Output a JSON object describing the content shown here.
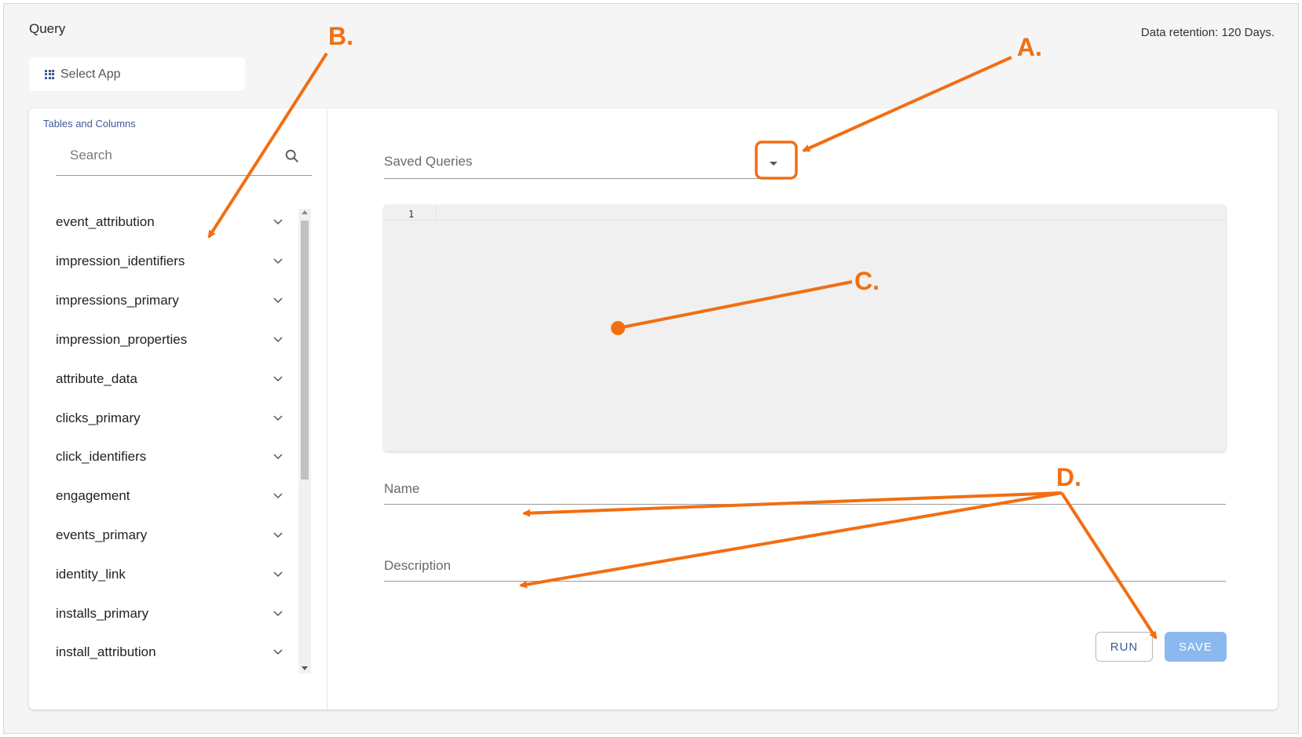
{
  "header": {
    "title": "Query",
    "retention": "Data retention: 120 Days."
  },
  "app_selector": {
    "label": "Select App",
    "icon": "grid-icon"
  },
  "sidebar": {
    "heading": "Tables and Columns",
    "search_placeholder": "Search",
    "tables": [
      {
        "name": "event_attribution"
      },
      {
        "name": "impression_identifiers"
      },
      {
        "name": "impressions_primary"
      },
      {
        "name": "impression_properties"
      },
      {
        "name": "attribute_data"
      },
      {
        "name": "clicks_primary"
      },
      {
        "name": "click_identifiers"
      },
      {
        "name": "engagement"
      },
      {
        "name": "events_primary"
      },
      {
        "name": "identity_link"
      },
      {
        "name": "installs_primary"
      },
      {
        "name": "install_attribution"
      }
    ]
  },
  "main": {
    "saved_queries_label": "Saved Queries",
    "editor": {
      "line_number": "1"
    },
    "name_placeholder": "Name",
    "description_placeholder": "Description",
    "run_label": "RUN",
    "save_label": "SAVE"
  },
  "annotations": {
    "a": "A.",
    "b": "B.",
    "c": "C.",
    "d": "D."
  },
  "colors": {
    "accent": "#3d5a99",
    "annotation": "#f26e12",
    "save_button": "#8ab8ef"
  }
}
